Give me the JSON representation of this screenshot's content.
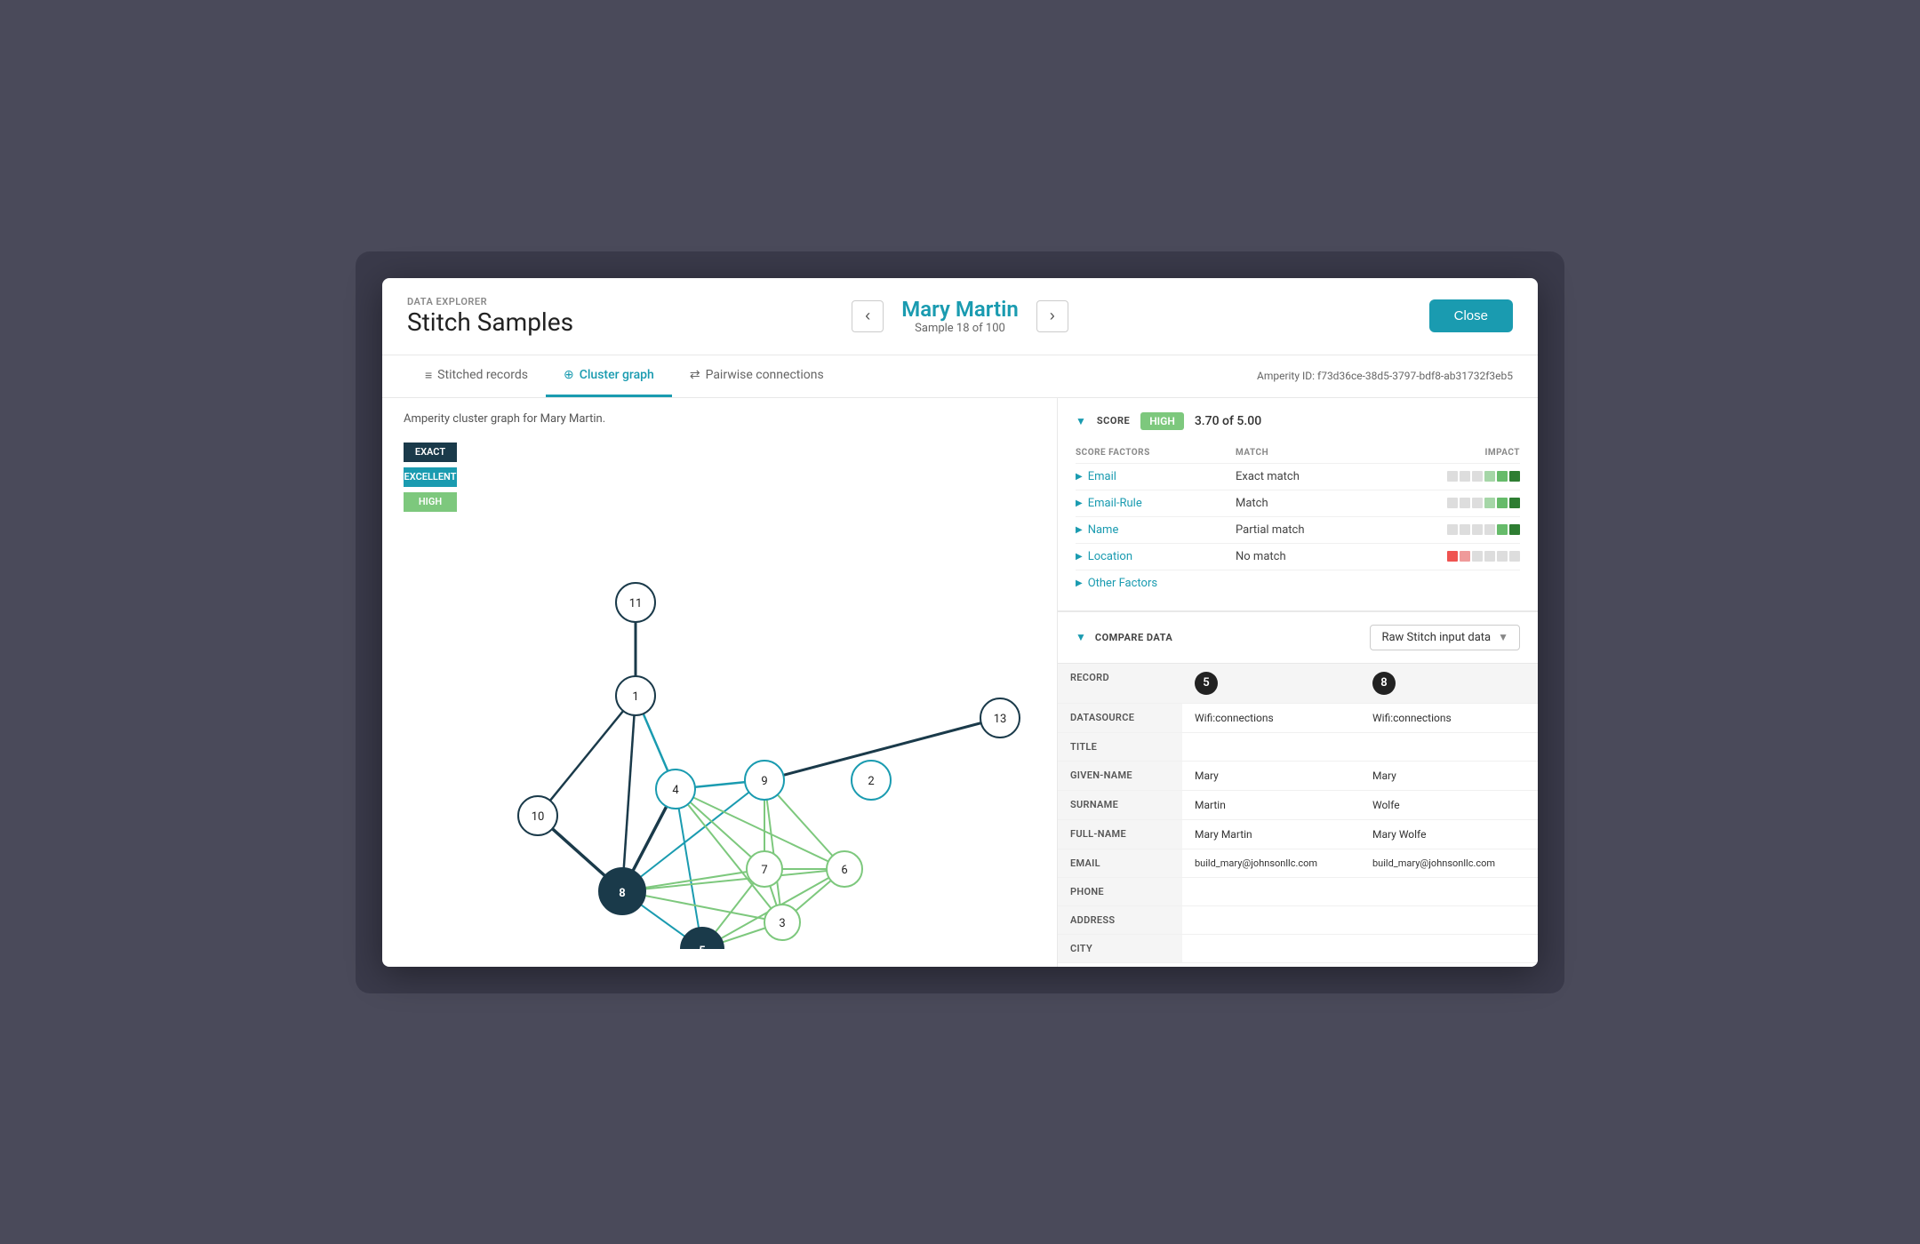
{
  "header": {
    "data_explorer_label": "DATA EXPLORER",
    "title": "Stitch Samples",
    "person_name": "Mary Martin",
    "sample_info": "Sample 18 of 100",
    "close_button": "Close",
    "amperity_id": "Amperity ID: f73d36ce-38d5-3797-bdf8-ab31732f3eb5"
  },
  "tabs": [
    {
      "id": "stitched-records",
      "icon": "≡",
      "label": "Stitched records",
      "active": false
    },
    {
      "id": "cluster-graph",
      "icon": "⊕",
      "label": "Cluster graph",
      "active": true
    },
    {
      "id": "pairwise-connections",
      "icon": "⇄",
      "label": "Pairwise connections",
      "active": false
    }
  ],
  "graph": {
    "description": "Amperity cluster graph for Mary Martin.",
    "legend": [
      {
        "id": "exact",
        "label": "EXACT",
        "color": "#1a3a4a"
      },
      {
        "id": "excellent",
        "label": "EXCELLENT",
        "color": "#1a9bb0"
      },
      {
        "id": "high",
        "label": "HIGH",
        "color": "#7dc87d"
      }
    ]
  },
  "score": {
    "section_label": "SCORE",
    "badge": "HIGH",
    "value": "3.70 of 5.00",
    "factors_headers": {
      "factor": "SCORE FACTORS",
      "match": "MATCH",
      "impact": "IMPACT"
    },
    "factors": [
      {
        "name": "Email",
        "match": "Exact match",
        "impact_type": "high_positive"
      },
      {
        "name": "Email-Rule",
        "match": "Match",
        "impact_type": "high_positive"
      },
      {
        "name": "Name",
        "match": "Partial match",
        "impact_type": "medium_positive"
      },
      {
        "name": "Location",
        "match": "No match",
        "impact_type": "negative"
      },
      {
        "name": "Other Factors",
        "match": "",
        "impact_type": "none"
      }
    ]
  },
  "compare": {
    "section_label": "COMPARE DATA",
    "dropdown_label": "Raw Stitch input data",
    "records": [
      "5",
      "8"
    ],
    "rows": [
      {
        "field": "RECORD",
        "col1": "5",
        "col2": "8",
        "is_record": true
      },
      {
        "field": "DATASOURCE",
        "col1": "Wifi:connections",
        "col2": "Wifi:connections"
      },
      {
        "field": "TITLE",
        "col1": "",
        "col2": ""
      },
      {
        "field": "GIVEN-NAME",
        "col1": "Mary",
        "col2": "Mary"
      },
      {
        "field": "SURNAME",
        "col1": "Martin",
        "col2": "Wolfe"
      },
      {
        "field": "FULL-NAME",
        "col1": "Mary Martin",
        "col2": "Mary Wolfe"
      },
      {
        "field": "EMAIL",
        "col1": "build_mary@johnsonllc.com",
        "col2": "build_mary@johnsonllc.com"
      },
      {
        "field": "PHONE",
        "col1": "",
        "col2": ""
      },
      {
        "field": "ADDRESS",
        "col1": "",
        "col2": ""
      },
      {
        "field": "CITY",
        "col1": "",
        "col2": ""
      }
    ]
  }
}
